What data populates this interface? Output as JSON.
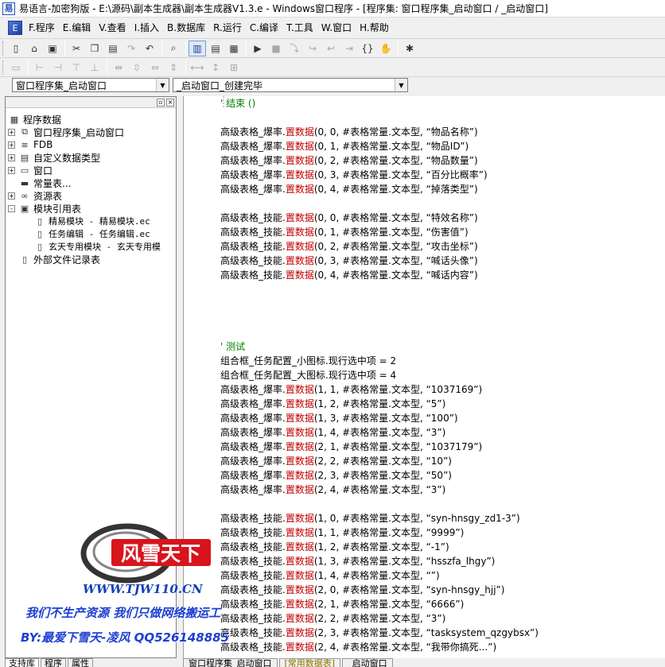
{
  "window": {
    "title": "易语言-加密狗版 - E:\\源码\\副本生成器\\副本生成器V1.3.e - Windows窗口程序 - [程序集: 窗口程序集_启动窗口 / _启动窗口]"
  },
  "menu": {
    "items": [
      "F.程序",
      "E.编辑",
      "V.查看",
      "I.插入",
      "B.数据库",
      "R.运行",
      "C.编译",
      "T.工具",
      "W.窗口",
      "H.帮助"
    ]
  },
  "combos": {
    "left_value": "窗口程序集_启动窗口",
    "right_value": "_启动窗口_创建完毕"
  },
  "tree": {
    "root": "程序数据",
    "nodes": [
      {
        "label": "窗口程序集_启动窗口",
        "level": 1,
        "expander": "+",
        "icon": "assembly-icon"
      },
      {
        "label": "FDB",
        "level": 1,
        "expander": "+",
        "icon": "database-icon"
      },
      {
        "label": "自定义数据类型",
        "level": 1,
        "expander": "+",
        "icon": "datatype-icon"
      },
      {
        "label": "窗口",
        "level": 1,
        "expander": "+",
        "icon": "window-icon"
      },
      {
        "label": "常量表...",
        "level": 1,
        "expander": "",
        "icon": "constant-icon"
      },
      {
        "label": "资源表",
        "level": 1,
        "expander": "+",
        "icon": "resource-icon"
      },
      {
        "label": "模块引用表",
        "level": 1,
        "expander": "-",
        "icon": "module-icon"
      },
      {
        "label": "精易模块 - 精易模块.ec",
        "level": 2,
        "expander": "",
        "icon": "file-icon"
      },
      {
        "label": "任务编辑 - 任务编辑.ec",
        "level": 2,
        "expander": "",
        "icon": "file-icon"
      },
      {
        "label": "玄天专用模块 - 玄天专用模",
        "level": 2,
        "expander": "",
        "icon": "file-icon"
      },
      {
        "label": "外部文件记录表",
        "level": 1,
        "expander": "",
        "icon": "file-icon"
      }
    ]
  },
  "left_tabs": [
    "支持库",
    "程序",
    "属性"
  ],
  "editor_tabs": [
    "窗口程序集_启动窗口",
    "[常用数据表]",
    "_启动窗口"
  ],
  "code": [
    {
      "type": "comment",
      "text": "' 结束 ()"
    },
    {
      "type": "blank"
    },
    {
      "type": "call",
      "obj": "高级表格_爆率",
      "fn": "置数据",
      "args": "(0, 0, #表格常量.文本型, ",
      "str": "“物品名称”",
      "end": ")"
    },
    {
      "type": "call",
      "obj": "高级表格_爆率",
      "fn": "置数据",
      "args": "(0, 1, #表格常量.文本型, ",
      "str": "“物品ID”",
      "end": ")"
    },
    {
      "type": "call",
      "obj": "高级表格_爆率",
      "fn": "置数据",
      "args": "(0, 2, #表格常量.文本型, ",
      "str": "“物品数量”",
      "end": ")"
    },
    {
      "type": "call",
      "obj": "高级表格_爆率",
      "fn": "置数据",
      "args": "(0, 3, #表格常量.文本型, ",
      "str": "“百分比概率”",
      "end": ")"
    },
    {
      "type": "call",
      "obj": "高级表格_爆率",
      "fn": "置数据",
      "args": "(0, 4, #表格常量.文本型, ",
      "str": "“掉落类型”",
      "end": ")"
    },
    {
      "type": "blank"
    },
    {
      "type": "call",
      "obj": "高级表格_技能",
      "fn": "置数据",
      "args": "(0, 0, #表格常量.文本型, ",
      "str": "“特效名称”",
      "end": ")"
    },
    {
      "type": "call",
      "obj": "高级表格_技能",
      "fn": "置数据",
      "args": "(0, 1, #表格常量.文本型, ",
      "str": "“伤害值”",
      "end": ")"
    },
    {
      "type": "call",
      "obj": "高级表格_技能",
      "fn": "置数据",
      "args": "(0, 2, #表格常量.文本型, ",
      "str": "“攻击坐标”",
      "end": ")"
    },
    {
      "type": "call",
      "obj": "高级表格_技能",
      "fn": "置数据",
      "args": "(0, 3, #表格常量.文本型, ",
      "str": "“喊话头像”",
      "end": ")"
    },
    {
      "type": "call",
      "obj": "高级表格_技能",
      "fn": "置数据",
      "args": "(0, 4, #表格常量.文本型, ",
      "str": "“喊话内容”",
      "end": ")"
    },
    {
      "type": "blank"
    },
    {
      "type": "blank"
    },
    {
      "type": "blank"
    },
    {
      "type": "blank"
    },
    {
      "type": "comment",
      "text": "' 测试"
    },
    {
      "type": "plain",
      "text": "组合框_任务配置_小图标.现行选中项 = 2"
    },
    {
      "type": "plain",
      "text": "组合框_任务配置_大图标.现行选中项 = 4"
    },
    {
      "type": "call",
      "obj": "高级表格_爆率",
      "fn": "置数据",
      "args": "(1, 1, #表格常量.文本型, ",
      "str": "“1037169”",
      "end": ")"
    },
    {
      "type": "call",
      "obj": "高级表格_爆率",
      "fn": "置数据",
      "args": "(1, 2, #表格常量.文本型, ",
      "str": "“5”",
      "end": ")"
    },
    {
      "type": "call",
      "obj": "高级表格_爆率",
      "fn": "置数据",
      "args": "(1, 3, #表格常量.文本型, ",
      "str": "“100”",
      "end": ")"
    },
    {
      "type": "call",
      "obj": "高级表格_爆率",
      "fn": "置数据",
      "args": "(1, 4, #表格常量.文本型, ",
      "str": "“3”",
      "end": ")"
    },
    {
      "type": "call",
      "obj": "高级表格_爆率",
      "fn": "置数据",
      "args": "(2, 1, #表格常量.文本型, ",
      "str": "“1037179”",
      "end": ")"
    },
    {
      "type": "call",
      "obj": "高级表格_爆率",
      "fn": "置数据",
      "args": "(2, 2, #表格常量.文本型, ",
      "str": "“10”",
      "end": ")"
    },
    {
      "type": "call",
      "obj": "高级表格_爆率",
      "fn": "置数据",
      "args": "(2, 3, #表格常量.文本型, ",
      "str": "“50”",
      "end": ")"
    },
    {
      "type": "call",
      "obj": "高级表格_爆率",
      "fn": "置数据",
      "args": "(2, 4, #表格常量.文本型, ",
      "str": "“3”",
      "end": ")"
    },
    {
      "type": "blank"
    },
    {
      "type": "call",
      "obj": "高级表格_技能",
      "fn": "置数据",
      "args": "(1, 0, #表格常量.文本型, ",
      "str": "“syn-hnsgy_zd1-3”",
      "end": ")"
    },
    {
      "type": "call",
      "obj": "高级表格_技能",
      "fn": "置数据",
      "args": "(1, 1, #表格常量.文本型, ",
      "str": "“9999”",
      "end": ")"
    },
    {
      "type": "call",
      "obj": "高级表格_技能",
      "fn": "置数据",
      "args": "(1, 2, #表格常量.文本型, ",
      "str": "“-1”",
      "end": ")"
    },
    {
      "type": "call",
      "obj": "高级表格_技能",
      "fn": "置数据",
      "args": "(1, 3, #表格常量.文本型, ",
      "str": "“hsszfa_lhgy”",
      "end": ")"
    },
    {
      "type": "call",
      "obj": "高级表格_技能",
      "fn": "置数据",
      "args": "(1, 4, #表格常量.文本型, ",
      "str": "“”",
      "end": ")"
    },
    {
      "type": "call",
      "obj": "高级表格_技能",
      "fn": "置数据",
      "args": "(2, 0, #表格常量.文本型, ",
      "str": "“syn-hnsgy_hjj”",
      "end": ")"
    },
    {
      "type": "call",
      "obj": "高级表格_技能",
      "fn": "置数据",
      "args": "(2, 1, #表格常量.文本型, ",
      "str": "“6666”",
      "end": ")"
    },
    {
      "type": "call",
      "obj": "高级表格_技能",
      "fn": "置数据",
      "args": "(2, 2, #表格常量.文本型, ",
      "str": "“3”",
      "end": ")"
    },
    {
      "type": "call",
      "obj": "高级表格_技能",
      "fn": "置数据",
      "args": "(2, 3, #表格常量.文本型, ",
      "str": "“tasksystem_qzgybsx”",
      "end": ")"
    },
    {
      "type": "call",
      "obj": "高级表格_技能",
      "fn": "置数据",
      "args": "(2, 4, #表格常量.文本型, ",
      "str": "“我带你搞死...”",
      "end": ")"
    }
  ],
  "watermark": {
    "logo_text": "风雪天下",
    "url": "WWW.TJW110.CN",
    "slogan": "我们不生产资源  我们只做网络搬运工",
    "by": "BY:最爱下雪天-凌风 QQ526148885"
  },
  "colors": {
    "function_name": "#c00000",
    "comment": "#008000",
    "watermark_blue": "#1d3fd0",
    "logo_red": "#d8141c"
  }
}
